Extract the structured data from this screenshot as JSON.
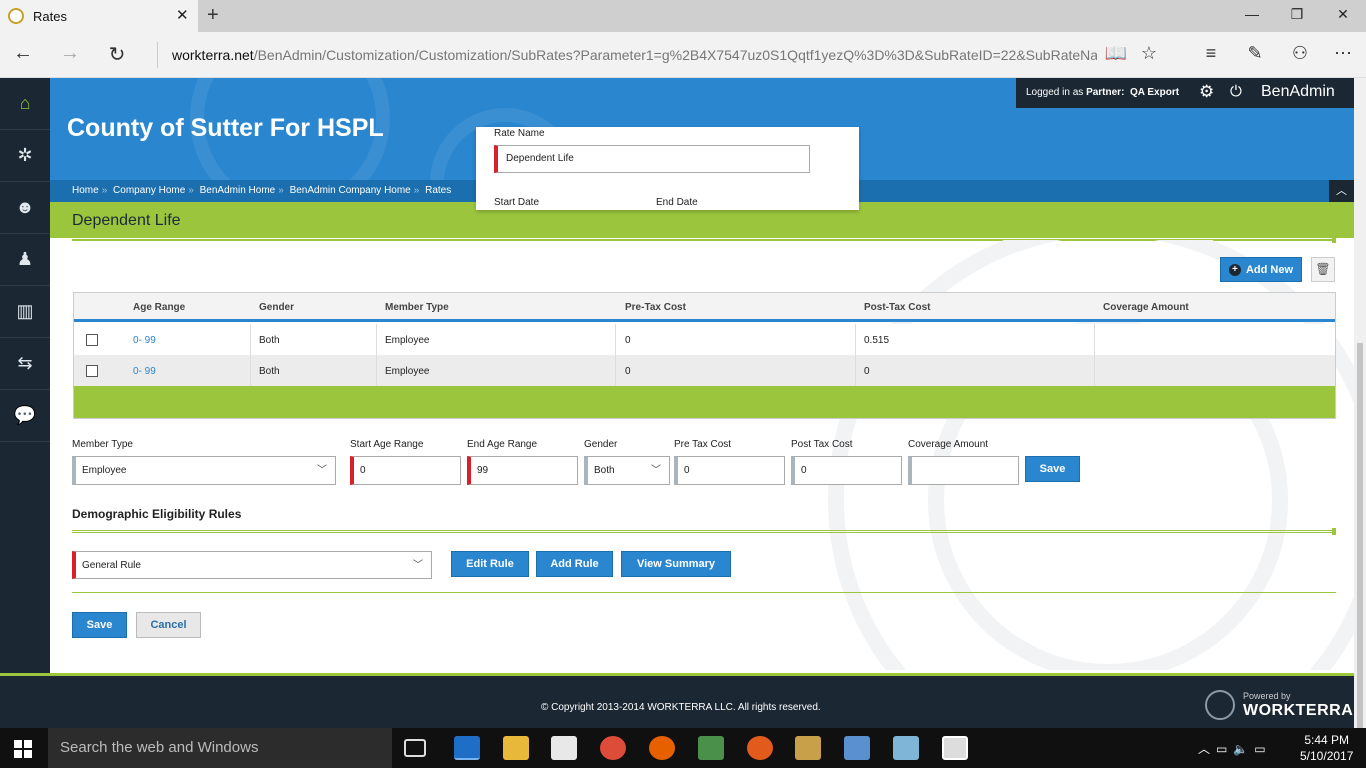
{
  "browser": {
    "tab_title": "Rates",
    "url_host": "workterra.net",
    "url_path": "/BenAdmin/Customization/Customization/SubRates?Parameter1=g%2B4X7547uz0S1Qqtf1yezQ%3D%3D&SubRateID=22&SubRateName=Depend"
  },
  "header": {
    "company": "County of Sutter For HSPL",
    "logged_in_prefix": "Logged in as",
    "partner_label": "Partner:",
    "partner_name": "QA Export",
    "brand": "BenAdmin",
    "breadcrumbs": [
      "Home",
      "Company Home",
      "BenAdmin Home",
      "BenAdmin Company Home",
      "Rates"
    ]
  },
  "popup": {
    "rate_name_label": "Rate Name",
    "rate_name_value": "Dependent Life",
    "start_date_label": "Start Date",
    "end_date_label": "End Date"
  },
  "page": {
    "title": "Dependent Life",
    "add_new_label": "Add New"
  },
  "grid": {
    "columns": [
      "Age Range",
      "Gender",
      "Member Type",
      "Pre-Tax Cost",
      "Post-Tax Cost",
      "Coverage Amount"
    ],
    "rows": [
      {
        "age_range": "0- 99",
        "gender": "Both",
        "member_type": "Employee",
        "pre_tax": "0",
        "post_tax": "0.515",
        "coverage": ""
      },
      {
        "age_range": "0- 99",
        "gender": "Both",
        "member_type": "Employee",
        "pre_tax": "0",
        "post_tax": "0",
        "coverage": ""
      }
    ]
  },
  "form": {
    "member_type_label": "Member Type",
    "member_type_value": "Employee",
    "start_age_label": "Start Age Range",
    "start_age_value": "0",
    "end_age_label": "End Age Range",
    "end_age_value": "99",
    "gender_label": "Gender",
    "gender_value": "Both",
    "pre_tax_label": "Pre Tax Cost",
    "pre_tax_value": "0",
    "post_tax_label": "Post Tax Cost",
    "post_tax_value": "0",
    "coverage_label": "Coverage Amount",
    "coverage_value": "",
    "save_label": "Save"
  },
  "demographic": {
    "title": "Demographic Eligibility Rules",
    "rule_value": "General Rule",
    "edit_rule": "Edit Rule",
    "add_rule": "Add Rule",
    "view_summary": "View Summary"
  },
  "actions": {
    "save": "Save",
    "cancel": "Cancel"
  },
  "footer": {
    "copyright": "© Copyright 2013-2014 WORKTERRA LLC. All rights reserved.",
    "powered_by": "Powered by",
    "powered_brand": "WORKTERRA"
  },
  "taskbar": {
    "search_placeholder": "Search the web and Windows",
    "time": "5:44 PM",
    "date": "5/10/2017"
  },
  "colors": {
    "brand_blue": "#2a86cf",
    "brand_green": "#9bc53d",
    "dark_navy": "#1b2733",
    "required_red": "#d9202a"
  }
}
